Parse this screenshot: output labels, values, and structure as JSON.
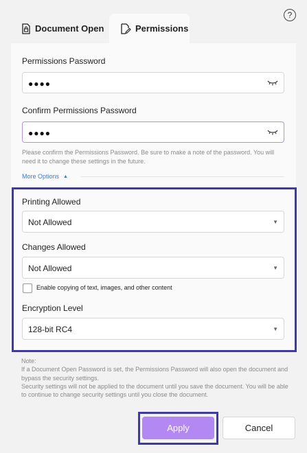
{
  "help_icon": "question-circle-icon",
  "tabs": [
    {
      "label": "Document Open",
      "icon": "lock-document-icon",
      "active": false
    },
    {
      "label": "Permissions",
      "icon": "edit-document-icon",
      "active": true
    }
  ],
  "permissions_password": {
    "label": "Permissions Password",
    "value": "●●●●",
    "icon": "eye-closed-icon"
  },
  "confirm_password": {
    "label": "Confirm Permissions Password",
    "value": "●●●●",
    "icon": "eye-closed-icon"
  },
  "hint": "Please confirm the Permissions Password. Be sure to make a note of the password. You will need it to change these settings in the future.",
  "more_options": {
    "label": "More Options",
    "icon": "caret-up-icon"
  },
  "printing": {
    "label": "Printing Allowed",
    "value": "Not Allowed"
  },
  "changes": {
    "label": "Changes Allowed",
    "value": "Not Allowed"
  },
  "copy_checkbox": {
    "label": "Enable copying of text, images, and other content",
    "checked": false
  },
  "encryption": {
    "label": "Encryption Level",
    "value": "128-bit RC4"
  },
  "note": {
    "title": "Note:",
    "line1": "If a Document Open Password is set, the Permissions Password will also open the document and bypass the security settings.",
    "line2": "Security settings will not be applied to the document until you save the document. You will be able to continue to change security settings until you close the document."
  },
  "buttons": {
    "apply": "Apply",
    "cancel": "Cancel"
  },
  "colors": {
    "accent": "#b388f2",
    "highlight_border": "#3d3aa8",
    "link": "#3a7ad3"
  }
}
